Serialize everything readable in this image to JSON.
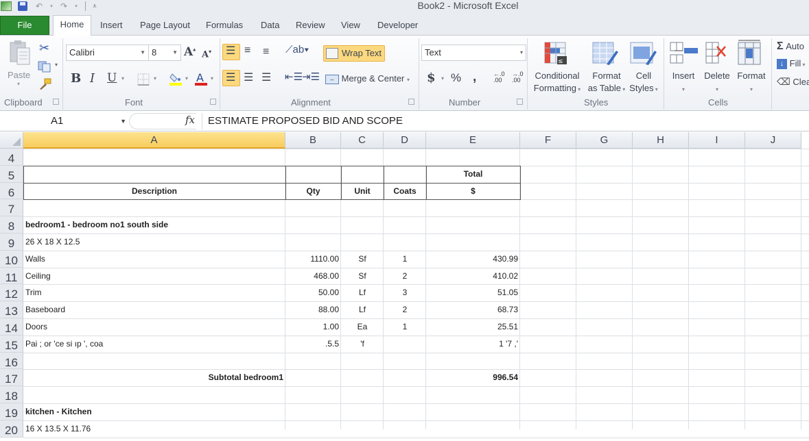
{
  "window": {
    "title": "Book2  -  Microsoft Excel"
  },
  "qat": {
    "icons": [
      "excel-logo-icon",
      "save-icon",
      "undo-icon",
      "redo-icon",
      "customize-qat-icon"
    ]
  },
  "tabs": [
    {
      "label": "File"
    },
    {
      "label": "Home"
    },
    {
      "label": "Insert"
    },
    {
      "label": "Page Layout"
    },
    {
      "label": "Formulas"
    },
    {
      "label": "Data"
    },
    {
      "label": "Review"
    },
    {
      "label": "View"
    },
    {
      "label": "Developer"
    }
  ],
  "ribbon": {
    "clipboard": {
      "label": "Clipboard",
      "paste": "Paste"
    },
    "font": {
      "label": "Font",
      "font_name": "Calibri",
      "font_size": "8",
      "bold": "B",
      "italic": "I",
      "underline": "U",
      "fill_color": "#ffff00",
      "font_color": "#e02020"
    },
    "alignment": {
      "label": "Alignment",
      "wrap_text": "Wrap Text",
      "merge_center": "Merge & Center"
    },
    "number": {
      "label": "Number",
      "format": "Text",
      "currency": "$",
      "percent": "%",
      "comma": ",",
      "inc_decimal": "+.0 .00",
      "dec_decimal": ".00 .0"
    },
    "styles": {
      "label": "Styles",
      "conditional_1": "Conditional",
      "conditional_2": "Formatting",
      "format_table_1": "Format",
      "format_table_2": "as Table",
      "cell_styles_1": "Cell",
      "cell_styles_2": "Styles"
    },
    "cells": {
      "label": "Cells",
      "insert": "Insert",
      "delete": "Delete",
      "format": "Format"
    },
    "editing": {
      "autosum": "Auto",
      "fill": "Fill",
      "clear": "Clea"
    }
  },
  "formula_bar": {
    "name_box": "A1",
    "fx": "fx",
    "content": "ESTIMATE PROPOSED BID AND SCOPE"
  },
  "columns": [
    "A",
    "B",
    "C",
    "D",
    "E",
    "F",
    "G",
    "H",
    "I",
    "J"
  ],
  "selected_column": "A",
  "rows": [
    {
      "num": "4",
      "A": "",
      "B": "",
      "C": "",
      "D": "",
      "E": ""
    },
    {
      "num": "5",
      "A": "",
      "B": "",
      "C": "",
      "D": "",
      "E": "Total"
    },
    {
      "num": "6",
      "A": "Description",
      "B": "Qty",
      "C": "Unit",
      "D": "Coats",
      "E": "$"
    },
    {
      "num": "7",
      "A": "",
      "B": "",
      "C": "",
      "D": "",
      "E": ""
    },
    {
      "num": "8",
      "A": "bedroom1 - bedroom no1 south side",
      "B": "",
      "C": "",
      "D": "",
      "E": ""
    },
    {
      "num": "9",
      "A": "26 X 18 X 12.5",
      "B": "",
      "C": "",
      "D": "",
      "E": ""
    },
    {
      "num": "10",
      "A": "Walls",
      "B": "1110.00",
      "C": "Sf",
      "D": "1",
      "E": "430.99"
    },
    {
      "num": "11",
      "A": "Ceiling",
      "B": "468.00",
      "C": "Sf",
      "D": "2",
      "E": "410.02"
    },
    {
      "num": "12",
      "A": "Trim",
      "B": "50.00",
      "C": "Lf",
      "D": "3",
      "E": "51.05"
    },
    {
      "num": "13",
      "A": "Baseboard",
      "B": "88.00",
      "C": "Lf",
      "D": "2",
      "E": "68.73"
    },
    {
      "num": "14",
      "A": "Doors",
      "B": "1.00",
      "C": "Ea",
      "D": "1",
      "E": "25.51"
    },
    {
      "num": "15",
      "A": "Pai  ;  or  'ce  si  ıp  ',   coa",
      "B": ".5.5",
      "C": "'f",
      "D": "",
      "E": "1  '7 ,'"
    },
    {
      "num": "16",
      "A": "",
      "B": "",
      "C": "",
      "D": "",
      "E": ""
    },
    {
      "num": "17",
      "A": "Subtotal bedroom1",
      "B": "",
      "C": "",
      "D": "",
      "E": "996.54"
    },
    {
      "num": "18",
      "A": "",
      "B": "",
      "C": "",
      "D": "",
      "E": ""
    },
    {
      "num": "19",
      "A": "kitchen - Kitchen",
      "B": "",
      "C": "",
      "D": "",
      "E": ""
    },
    {
      "num": "20",
      "A": "16 X 13.5 X 11.76",
      "B": "",
      "C": "",
      "D": "",
      "E": ""
    }
  ]
}
